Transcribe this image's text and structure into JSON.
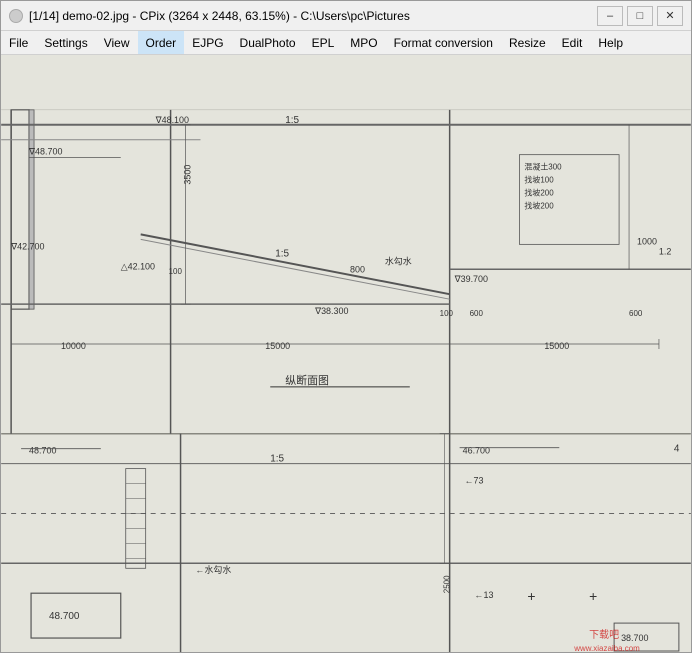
{
  "window": {
    "title": "[1/14] demo-02.jpg - CPix (3264 x 2448, 63.15%) - C:\\Users\\pc\\Pictures",
    "icon": "○"
  },
  "titlebar": {
    "minimize_label": "–",
    "maximize_label": "□",
    "close_label": "✕"
  },
  "menu": {
    "items": [
      {
        "label": "File",
        "active": false
      },
      {
        "label": "Settings",
        "active": false
      },
      {
        "label": "View",
        "active": false
      },
      {
        "label": "Order",
        "active": true
      },
      {
        "label": "EJPG",
        "active": false
      },
      {
        "label": "DualPhoto",
        "active": false
      },
      {
        "label": "EPL",
        "active": false
      },
      {
        "label": "MPO",
        "active": false
      },
      {
        "label": "Format conversion",
        "active": false
      },
      {
        "label": "Resize",
        "active": false
      },
      {
        "label": "Edit",
        "active": false
      },
      {
        "label": "Help",
        "active": false
      }
    ]
  },
  "watermark": {
    "text": "下载吧",
    "url_text": "www.xiazaiba.com"
  }
}
